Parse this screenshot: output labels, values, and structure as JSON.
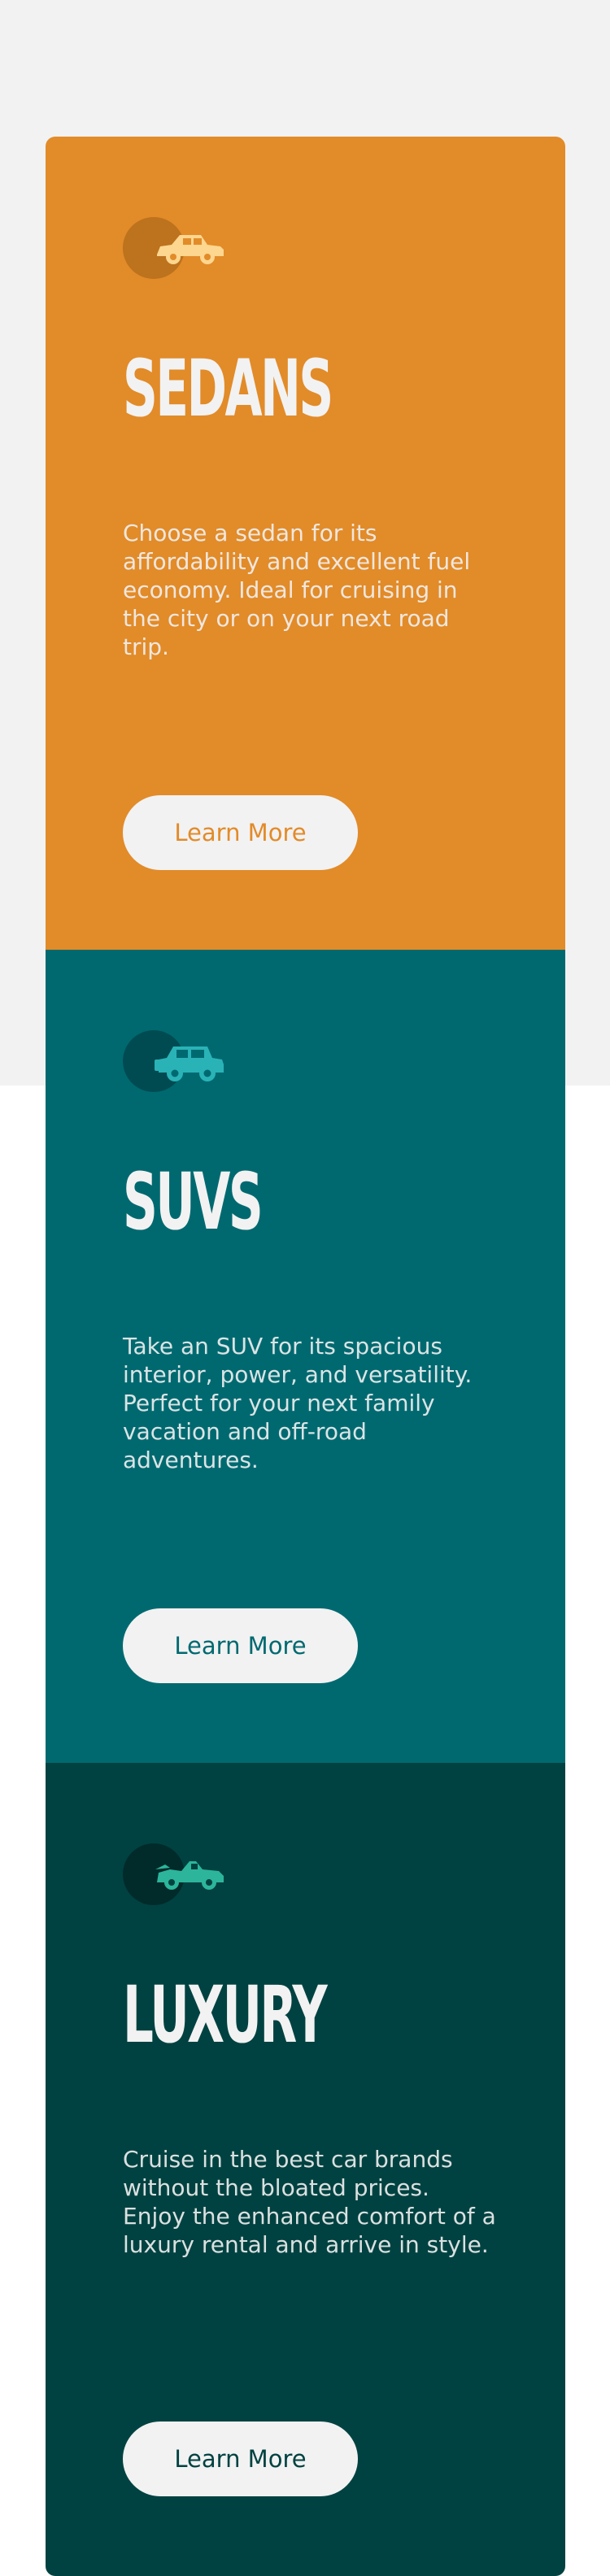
{
  "cards": [
    {
      "icon": "sedan-car-icon",
      "title": "Sedans",
      "description": "Choose a sedan for its affordability and excellent fuel economy. Ideal for cruising in the city or on your next road trip.",
      "button_label": "Learn More",
      "color": "#e28b29"
    },
    {
      "icon": "suv-car-icon",
      "title": "SUVs",
      "description": "Take an SUV for its spacious interior, power, and versatility. Perfect for your next family vacation and off-road adventures.",
      "button_label": "Learn More",
      "color": "#006970"
    },
    {
      "icon": "luxury-car-icon",
      "title": "Luxury",
      "description": "Cruise in the best car brands without the bloated prices. Enjoy the enhanced comfort of a luxury rental and arrive in style.",
      "button_label": "Learn More",
      "color": "#004241"
    }
  ],
  "colors": {
    "background": "#f2f2f2",
    "button_bg": "#f2f2f2",
    "text_light": "#f2f2f2",
    "sedan_icon": "#fdd68f",
    "suv_icon": "#2ab3b7",
    "luxury_icon": "#2cb59b"
  }
}
